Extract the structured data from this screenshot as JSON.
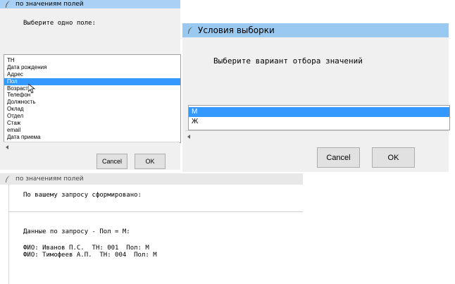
{
  "dialog1": {
    "title": "по значениям полей",
    "prompt": "Выберите одно поле:",
    "fields": [
      "ТН",
      "Дата рождения",
      "Адрес",
      "Пол",
      "Возраст",
      "Телефон",
      "Должность",
      "Оклад",
      "Отдел",
      "Стаж",
      "email",
      "Дата приема"
    ],
    "selected_index": 3,
    "cancel_label": "Cancel",
    "ok_label": "OK"
  },
  "dialog2": {
    "title": "Условия выборки",
    "prompt": "Выберите вариант отбора значений",
    "options": [
      "М",
      "Ж"
    ],
    "selected_index": 0,
    "cancel_label": "Cancel",
    "ok_label": "OK"
  },
  "dialog3": {
    "title": "по значениям полей",
    "header": "По вашему запросу сформировано:",
    "query": "Данные по запросу - Пол = М:",
    "results": [
      "ФИО: Иванов П.С.  ТН: 001  Пол: М",
      "ФИО: Тимофеев А.П.  ТН: 004  Пол: М"
    ]
  },
  "colors": {
    "selection": "#3399ff",
    "titlebar_active": "#99c9f0",
    "titlebar_inactive": "#e6e6e6"
  }
}
